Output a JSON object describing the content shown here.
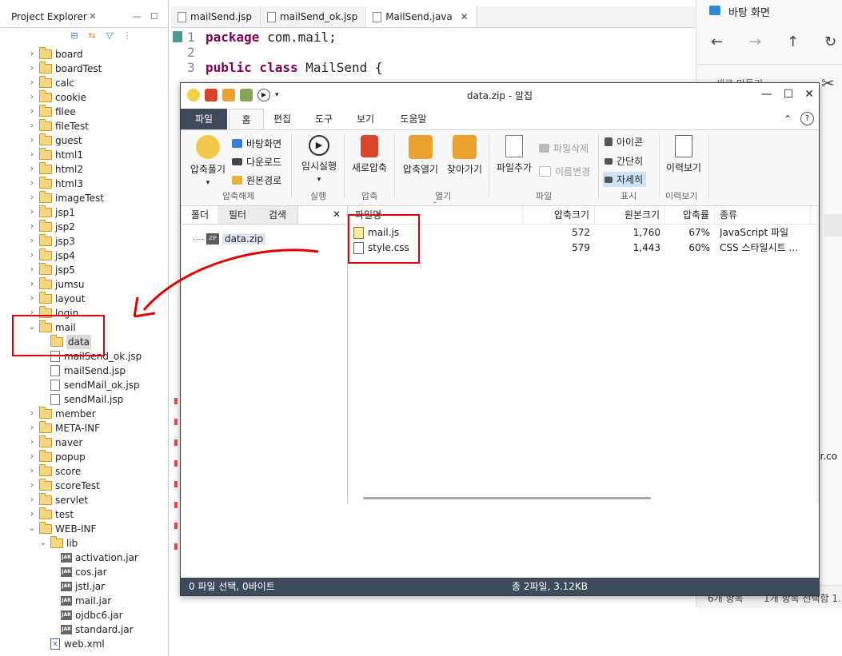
{
  "project_explorer": {
    "title": "Project Explorer",
    "items": [
      {
        "label": "board",
        "type": "folder",
        "level": 0,
        "expanded": false
      },
      {
        "label": "boardTest",
        "type": "folder",
        "level": 0,
        "expanded": false
      },
      {
        "label": "calc",
        "type": "folder",
        "level": 0,
        "expanded": false
      },
      {
        "label": "cookie",
        "type": "folder",
        "level": 0,
        "expanded": false
      },
      {
        "label": "filee",
        "type": "folder",
        "level": 0,
        "expanded": false
      },
      {
        "label": "fileTest",
        "type": "folder",
        "level": 0,
        "expanded": false
      },
      {
        "label": "guest",
        "type": "folder",
        "level": 0,
        "expanded": false
      },
      {
        "label": "html1",
        "type": "folder",
        "level": 0,
        "expanded": false
      },
      {
        "label": "html2",
        "type": "folder",
        "level": 0,
        "expanded": false
      },
      {
        "label": "html3",
        "type": "folder",
        "level": 0,
        "expanded": false
      },
      {
        "label": "imageTest",
        "type": "folder",
        "level": 0,
        "expanded": false
      },
      {
        "label": "jsp1",
        "type": "folder",
        "level": 0,
        "expanded": false
      },
      {
        "label": "jsp2",
        "type": "folder",
        "level": 0,
        "expanded": false
      },
      {
        "label": "jsp3",
        "type": "folder",
        "level": 0,
        "expanded": false
      },
      {
        "label": "jsp4",
        "type": "folder",
        "level": 0,
        "expanded": false
      },
      {
        "label": "jsp5",
        "type": "folder",
        "level": 0,
        "expanded": false
      },
      {
        "label": "jumsu",
        "type": "folder",
        "level": 0,
        "expanded": false
      },
      {
        "label": "layout",
        "type": "folder",
        "level": 0,
        "expanded": false
      },
      {
        "label": "login",
        "type": "folder",
        "level": 0,
        "expanded": false
      },
      {
        "label": "mail",
        "type": "folder",
        "level": 0,
        "expanded": true
      },
      {
        "label": "data",
        "type": "folder",
        "level": 1,
        "selected": true
      },
      {
        "label": "mailSend_ok.jsp",
        "type": "file",
        "level": 1
      },
      {
        "label": "mailSend.jsp",
        "type": "file",
        "level": 1
      },
      {
        "label": "sendMail_ok.jsp",
        "type": "file",
        "level": 1
      },
      {
        "label": "sendMail.jsp",
        "type": "file",
        "level": 1
      },
      {
        "label": "member",
        "type": "folder",
        "level": 0,
        "expanded": false
      },
      {
        "label": "META-INF",
        "type": "folder",
        "level": 0,
        "expanded": false
      },
      {
        "label": "naver",
        "type": "folder",
        "level": 0,
        "expanded": false
      },
      {
        "label": "popup",
        "type": "folder",
        "level": 0,
        "expanded": false
      },
      {
        "label": "score",
        "type": "folder",
        "level": 0,
        "expanded": false
      },
      {
        "label": "scoreTest",
        "type": "folder",
        "level": 0,
        "expanded": false
      },
      {
        "label": "servlet",
        "type": "folder",
        "level": 0,
        "expanded": false
      },
      {
        "label": "test",
        "type": "folder",
        "level": 0,
        "expanded": false
      },
      {
        "label": "WEB-INF",
        "type": "folder",
        "level": 0,
        "expanded": true
      },
      {
        "label": "lib",
        "type": "folder",
        "level": 1,
        "expanded": true
      },
      {
        "label": "activation.jar",
        "type": "jar",
        "level": 2
      },
      {
        "label": "cos.jar",
        "type": "jar",
        "level": 2
      },
      {
        "label": "jstl.jar",
        "type": "jar",
        "level": 2
      },
      {
        "label": "mail.jar",
        "type": "jar",
        "level": 2
      },
      {
        "label": "ojdbc6.jar",
        "type": "jar",
        "level": 2
      },
      {
        "label": "standard.jar",
        "type": "jar",
        "level": 2
      },
      {
        "label": "web.xml",
        "type": "xml",
        "level": 1
      }
    ]
  },
  "editor": {
    "tabs": [
      {
        "label": "mailSend.jsp",
        "active": false
      },
      {
        "label": "mailSend_ok.jsp",
        "active": false
      },
      {
        "label": "MailSend.java",
        "active": true,
        "close": "✕"
      }
    ],
    "lines": [
      {
        "num": "1",
        "kw": "package",
        "rest": " com.mail;"
      },
      {
        "num": "2",
        "kw": "",
        "rest": ""
      },
      {
        "num": "3",
        "kw": "public class",
        "rest": " MailSend {"
      }
    ]
  },
  "file_explorer": {
    "title": "바탕 화면",
    "partial_texts": [
      "새로 만들기",
      "ver.co",
      "6개 항목",
      "1개 항목 선택함 1."
    ]
  },
  "alzip": {
    "title": "data.zip - 알집",
    "menu_tabs": [
      "파일",
      "홈",
      "편집",
      "도구",
      "보기",
      "도움말"
    ],
    "ribbon": {
      "extract_big": "압축풀기",
      "extract_small": [
        "바탕화면",
        "다운로드",
        "원본경로"
      ],
      "run": "임시실행",
      "new_zip": "새로압축",
      "open_zip": "압축열기",
      "find": "찾아가기",
      "add_file": "파일추가",
      "delete_file": "파일삭제",
      "rename": "이름변경",
      "view_icon": "아이콘",
      "view_simple": "간단히",
      "view_detail": "자세히",
      "history": "이력보기",
      "groups": [
        "압축해제",
        "실행",
        "압축",
        "열기",
        "파일",
        "표시",
        "이력보기"
      ]
    },
    "left_tabs": [
      "폴더",
      "필터",
      "검색"
    ],
    "tree_root": "data.zip",
    "columns": [
      "파일명",
      "압축크기",
      "원본크기",
      "압축률",
      "종류"
    ],
    "files": [
      {
        "name": "mail.js",
        "compressed": "572",
        "original": "1,760",
        "ratio": "67%",
        "type": "JavaScript 파일"
      },
      {
        "name": "style.css",
        "compressed": "579",
        "original": "1,443",
        "ratio": "60%",
        "type": "CSS 스타일시트 ..."
      }
    ],
    "status_left": "0 파일 선택, 0바이트",
    "status_center": "총 2파일, 3.12KB"
  },
  "colors": {
    "annotation_red": "#e00000",
    "status_bar": "#3e4a5c",
    "keyword": "#7f0055"
  }
}
